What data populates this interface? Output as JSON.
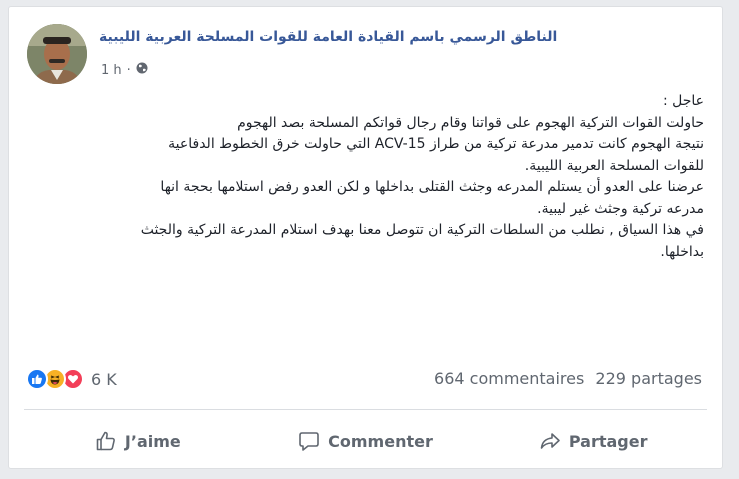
{
  "post": {
    "author": "الناطق الرسمي باسم القيادة العامة للقوات المسلحة العربية الليبية",
    "time": "1 h",
    "separator": "·",
    "body_lines": [
      "عاجل :",
      "حاولت القوات التركية الهجوم على قواتنا وقام رجال قواتكم المسلحة بصد الهجوم",
      "نتيجة الهجوم كانت تدمير مدرعة تركية من طراز  ACV-15 التي حاولت خرق الخطوط الدفاعية",
      "للقوات المسلحة العربية الليبية.",
      "عرضنا على العدو أن يستلم المدرعه وجثث القتلى بداخلها و لكن العدو رفض استلامها بحجة انها",
      "مدرعه تركية وجثث غير ليبية.",
      "في هذا السياق , نطلب من السلطات التركية ان تتوصل معنا بهدف استلام المدرعة التركية والجثث",
      "بداخلها."
    ]
  },
  "reactions": {
    "icons": [
      "like-icon",
      "haha-icon",
      "love-icon"
    ],
    "count": "6 K",
    "colors": {
      "like": "#1877f2",
      "haha": "#f7b125",
      "love": "#f33e58"
    }
  },
  "stats": {
    "comments": "664 commentaires",
    "shares": "229 partages"
  },
  "actions": {
    "like": "J’aime",
    "comment": "Commenter",
    "share": "Partager"
  },
  "colors": {
    "author_link": "#385898",
    "secondary_text": "#606770",
    "page_bg": "#e9ebee"
  }
}
